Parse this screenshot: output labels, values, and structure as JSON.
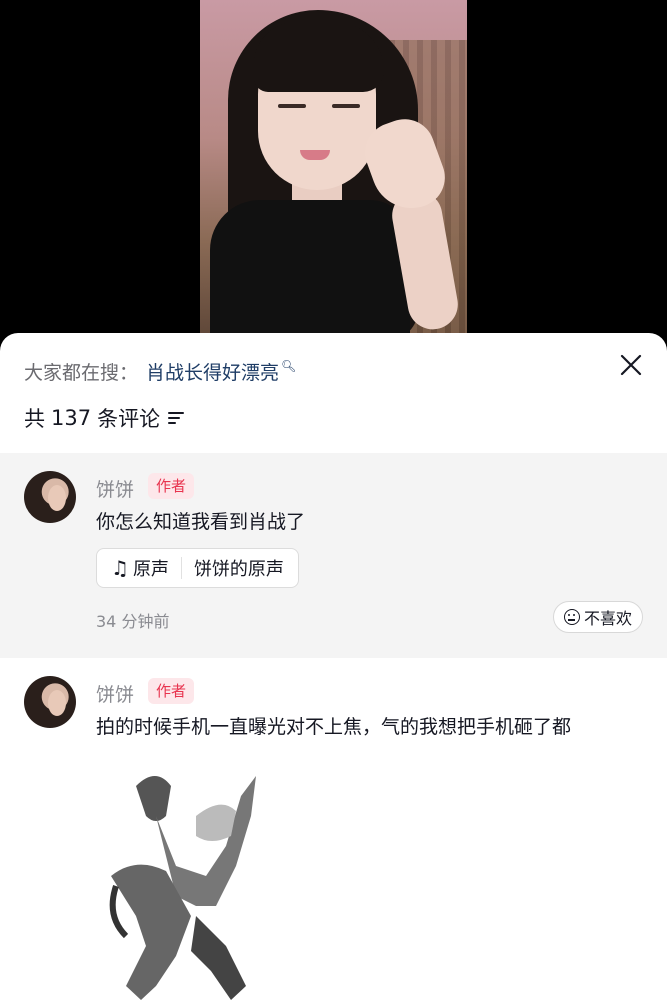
{
  "search": {
    "prefix": "大家都在搜：",
    "term": "肖战长得好漂亮"
  },
  "comments_header": {
    "prefix": "共",
    "count": "137",
    "suffix": "条评论"
  },
  "comments": [
    {
      "username": "饼饼",
      "tag": "作者",
      "text": "你怎么知道我看到肖战了",
      "sound": {
        "label": "原声",
        "title": "饼饼的原声"
      },
      "time": "34 分钟前",
      "dislike_label": "不喜欢"
    },
    {
      "username": "饼饼",
      "tag": "作者",
      "text": "拍的时候手机一直曝光对不上焦，气的我想把手机砸了都"
    }
  ],
  "colors": {
    "author_tag_bg": "#fde7ea",
    "author_tag_text": "#e8344f",
    "search_term": "#1f3d66"
  }
}
